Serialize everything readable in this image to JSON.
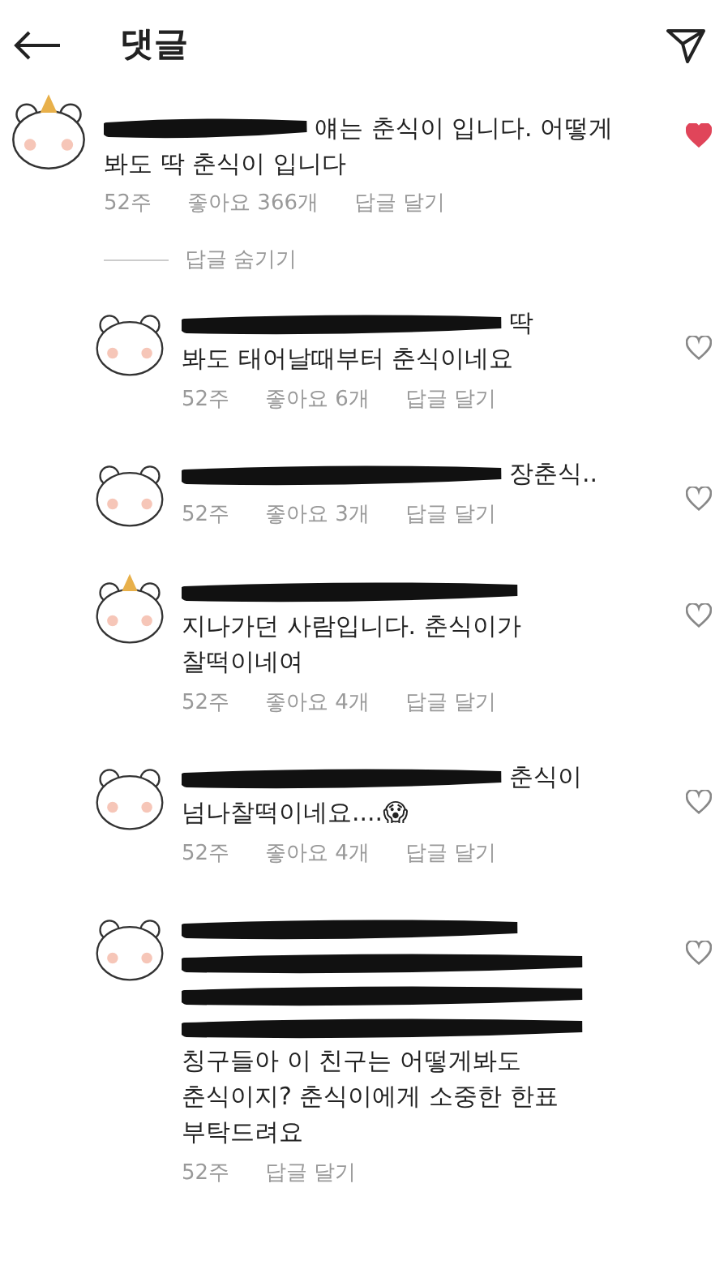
{
  "header": {
    "title": "댓글"
  },
  "comment": {
    "hat": true,
    "liked": true,
    "lines": [
      {
        "kind": "redacted_text",
        "text": "얘는 춘식이 입니다. 어떻게"
      },
      {
        "kind": "text",
        "text": "봐도 딱 춘식이 입니다"
      }
    ],
    "time": "52주",
    "likes": "좋아요 366개",
    "reply": "답글 달기"
  },
  "hide_replies": "답글 숨기기",
  "replies": [
    {
      "hat": false,
      "liked": false,
      "lines": [
        {
          "kind": "redacted_text",
          "text": "딱"
        },
        {
          "kind": "text",
          "text": "봐도 태어날때부터 춘식이네요"
        }
      ],
      "time": "52주",
      "likes": "좋아요 6개",
      "reply": "답글 달기"
    },
    {
      "hat": false,
      "liked": false,
      "lines": [
        {
          "kind": "redacted_text",
          "text": "장춘식.."
        }
      ],
      "time": "52주",
      "likes": "좋아요 3개",
      "reply": "답글 달기"
    },
    {
      "hat": true,
      "liked": false,
      "lines": [
        {
          "kind": "redacted"
        },
        {
          "kind": "text",
          "text": "지나가던 사람입니다. 춘식이가"
        },
        {
          "kind": "text",
          "text": "찰떡이네여"
        }
      ],
      "time": "52주",
      "likes": "좋아요 4개",
      "reply": "답글 달기"
    },
    {
      "hat": false,
      "liked": false,
      "lines": [
        {
          "kind": "redacted_text",
          "text": "춘식이"
        },
        {
          "kind": "text",
          "text": "넘나찰떡이네요....😱"
        }
      ],
      "time": "52주",
      "likes": "좋아요 4개",
      "reply": "답글 달기"
    },
    {
      "hat": false,
      "liked": false,
      "lines": [
        {
          "kind": "redacted"
        },
        {
          "kind": "redacted"
        },
        {
          "kind": "redacted"
        },
        {
          "kind": "redacted"
        },
        {
          "kind": "text",
          "text": "칭구들아 이 친구는 어떻게봐도"
        },
        {
          "kind": "text",
          "text": "춘식이지? 춘식이에게 소중한 한표"
        },
        {
          "kind": "text",
          "text": "부탁드려요"
        }
      ],
      "time": "52주",
      "reply": "답글 달기"
    }
  ]
}
